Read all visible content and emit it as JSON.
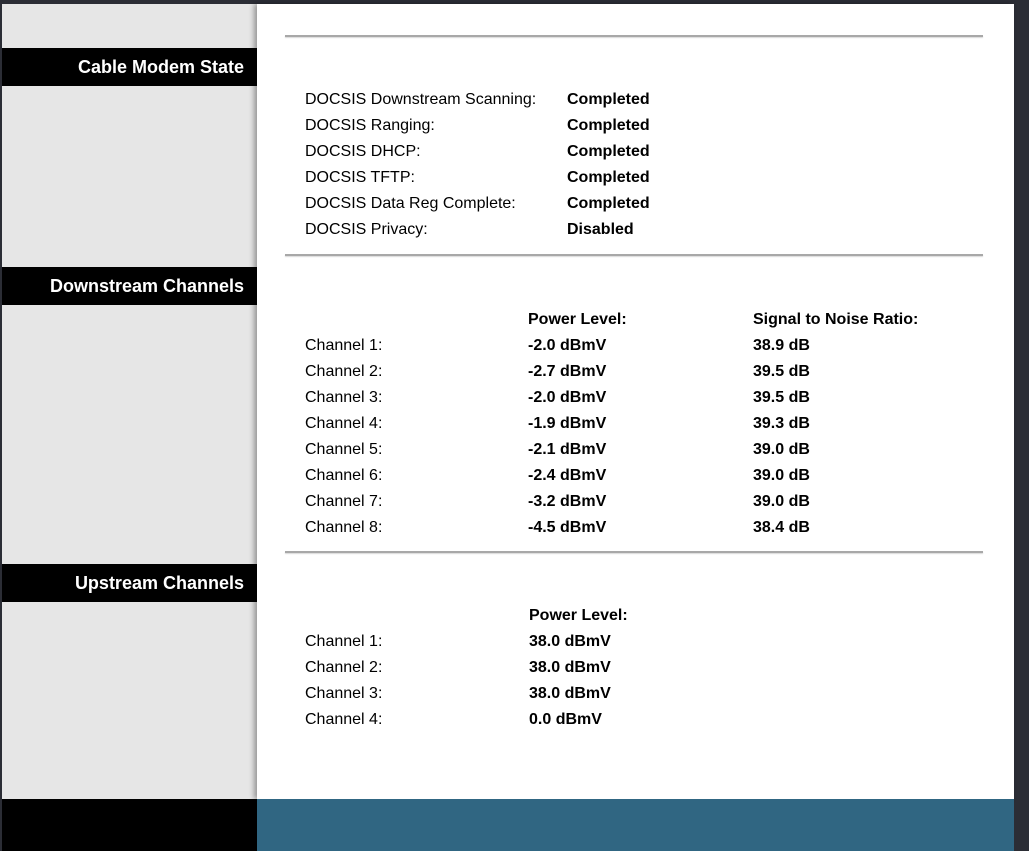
{
  "sections": {
    "cable_modem_state": {
      "title": "Cable Modem State",
      "rows": [
        {
          "label": "DOCSIS Downstream Scanning:",
          "value": "Completed"
        },
        {
          "label": "DOCSIS Ranging:",
          "value": "Completed"
        },
        {
          "label": "DOCSIS DHCP:",
          "value": "Completed"
        },
        {
          "label": "DOCSIS TFTP:",
          "value": "Completed"
        },
        {
          "label": "DOCSIS Data Reg Complete:",
          "value": "Completed"
        },
        {
          "label": "DOCSIS Privacy:",
          "value": "Disabled"
        }
      ]
    },
    "downstream": {
      "title": "Downstream Channels",
      "power_header": "Power Level:",
      "snr_header": "Signal to Noise Ratio:",
      "rows": [
        {
          "label": "Channel 1:",
          "power": "-2.0 dBmV",
          "snr": "38.9 dB"
        },
        {
          "label": "Channel 2:",
          "power": "-2.7 dBmV",
          "snr": "39.5 dB"
        },
        {
          "label": "Channel 3:",
          "power": "-2.0 dBmV",
          "snr": "39.5 dB"
        },
        {
          "label": "Channel 4:",
          "power": "-1.9 dBmV",
          "snr": "39.3 dB"
        },
        {
          "label": "Channel 5:",
          "power": "-2.1 dBmV",
          "snr": "39.0 dB"
        },
        {
          "label": "Channel 6:",
          "power": "-2.4 dBmV",
          "snr": "39.0 dB"
        },
        {
          "label": "Channel 7:",
          "power": "-3.2 dBmV",
          "snr": "39.0 dB"
        },
        {
          "label": "Channel 8:",
          "power": "-4.5 dBmV",
          "snr": "38.4 dB"
        }
      ]
    },
    "upstream": {
      "title": "Upstream Channels",
      "power_header": "Power Level:",
      "rows": [
        {
          "label": "Channel 1:",
          "power": "38.0 dBmV"
        },
        {
          "label": "Channel 2:",
          "power": "38.0 dBmV"
        },
        {
          "label": "Channel 3:",
          "power": "38.0 dBmV"
        },
        {
          "label": "Channel 4:",
          "power": "0.0 dBmV"
        }
      ]
    }
  }
}
